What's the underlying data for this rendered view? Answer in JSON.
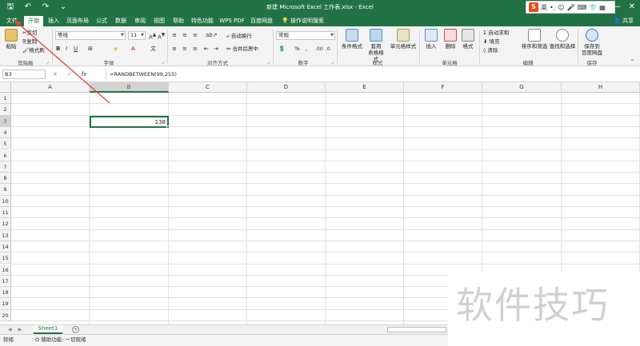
{
  "window": {
    "title": "新建 Microsoft Excel 工作表.xlsx - Excel",
    "quick_access": [
      "save-icon",
      "undo-icon",
      "redo-icon",
      "customize-icon"
    ],
    "controls": [
      "minimize-icon",
      "restore-icon",
      "close-icon"
    ]
  },
  "ime": {
    "logo": "S",
    "mode": "英"
  },
  "tabs": [
    {
      "label": "文件"
    },
    {
      "label": "开始"
    },
    {
      "label": "插入"
    },
    {
      "label": "页面布局"
    },
    {
      "label": "公式"
    },
    {
      "label": "数据"
    },
    {
      "label": "审阅"
    },
    {
      "label": "视图"
    },
    {
      "label": "帮助"
    },
    {
      "label": "特色功能"
    },
    {
      "label": "WPS PDF"
    },
    {
      "label": "百度网盘"
    }
  ],
  "tell_me": "操作说明搜索",
  "share": "共享",
  "ribbon": {
    "clipboard": {
      "paste": "粘贴",
      "cut": "剪切",
      "copy": "复制",
      "format_painter": "格式刷",
      "label": "剪贴板"
    },
    "font": {
      "name": "等线",
      "size": "11",
      "label": "字体"
    },
    "alignment": {
      "wrap": "自动换行",
      "merge": "合并后居中",
      "label": "对齐方式"
    },
    "number": {
      "format": "常规",
      "label": "数字"
    },
    "styles": {
      "conditional": "条件格式",
      "table1": "套用",
      "table2": "表格格式",
      "cell_styles": "单元格样式",
      "label": "样式"
    },
    "cells": {
      "insert": "插入",
      "delete": "删除",
      "format": "格式",
      "label": "单元格"
    },
    "editing": {
      "autosum": "自动求和",
      "fill": "填充",
      "clear": "清除",
      "sort": "排序和筛选",
      "find": "查找和选择",
      "label": "编辑"
    },
    "save": {
      "line1": "保存到",
      "line2": "百度网盘",
      "label": "保存"
    }
  },
  "formula_bar": {
    "name_box": "B3",
    "cancel": "✕",
    "enter": "✓",
    "fx": "fx",
    "formula": "=RANDBETWEEN(99,255)"
  },
  "grid": {
    "columns": [
      "A",
      "B",
      "C",
      "D",
      "E",
      "F",
      "G",
      "H"
    ],
    "rows": [
      "1",
      "2",
      "3",
      "4",
      "5",
      "6",
      "7",
      "8",
      "9",
      "10",
      "11",
      "12",
      "13",
      "14",
      "15",
      "16",
      "17",
      "18",
      "19",
      "20"
    ],
    "selected_column": "B",
    "selected_row": "3",
    "active_value": "138"
  },
  "sheets": {
    "active": "Sheet1",
    "add": "+"
  },
  "status": {
    "ready": "就绪",
    "accessibility": "辅助功能: 一切就绪"
  },
  "watermark": "软件技巧",
  "colors": {
    "accent": "#217346",
    "annotation": "#e0463a"
  }
}
